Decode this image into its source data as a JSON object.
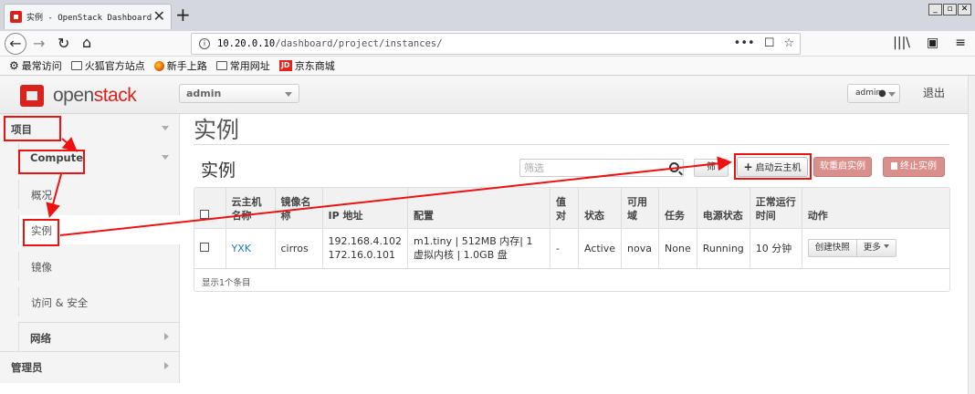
{
  "browser": {
    "tab_title": "实例 - OpenStack Dashboard",
    "tab_close": "✕",
    "new_tab": "+",
    "url_host": "10.20.0.10",
    "url_path": "/dashboard/project/instances/",
    "url_actions": [
      "•••",
      "☐",
      "☆"
    ],
    "nav_right": [
      "|||\\",
      "▣",
      "≡"
    ],
    "window_controls": [
      "_",
      "▫",
      "✕"
    ],
    "bookmarks": [
      "最常访问",
      "火狐官方站点",
      "新手上路",
      "常用网址",
      "京东商城"
    ],
    "jd_badge": "JD"
  },
  "header": {
    "logo_open": "open",
    "logo_stack": "stack",
    "project": "admin",
    "user": "admin",
    "logout": "退出"
  },
  "sidebar": {
    "project": "项目",
    "compute": "Compute",
    "overview": "概况",
    "instances": "实例",
    "images": "镜像",
    "access_security": "访问 & 安全",
    "network": "网络",
    "admin": "管理员"
  },
  "main": {
    "page_title": "实例",
    "section_title": "实例",
    "filter_placeholder": "筛选",
    "filter_button": "筛",
    "launch_button": "启动云主机",
    "soft_reboot_button": "软重启实例",
    "terminate_button": "终止实例",
    "footer": "显示1个条目"
  },
  "table": {
    "headers": [
      "云主机名称",
      "镜像名称",
      "IP 地址",
      "配置",
      "值对",
      "状态",
      "可用域",
      "任务",
      "电源状态",
      "正常运行时间",
      "动作"
    ],
    "rows": [
      {
        "name": "YXK",
        "image": "cirros",
        "ip1": "192.168.4.102",
        "ip2": "172.16.0.101",
        "flavor": "m1.tiny | 512MB 内存| 1 虚拟内核 | 1.0GB 盘",
        "keypair": "-",
        "status": "Active",
        "az": "nova",
        "task": "None",
        "power": "Running",
        "uptime": "10 分钟",
        "action_primary": "创建快照",
        "action_more": "更多"
      }
    ]
  },
  "colors": {
    "openstack_red": "#d9211e",
    "link_blue": "#1f78b4",
    "danger_button": "#d98f8c",
    "annotation_red": "#ee1111"
  }
}
